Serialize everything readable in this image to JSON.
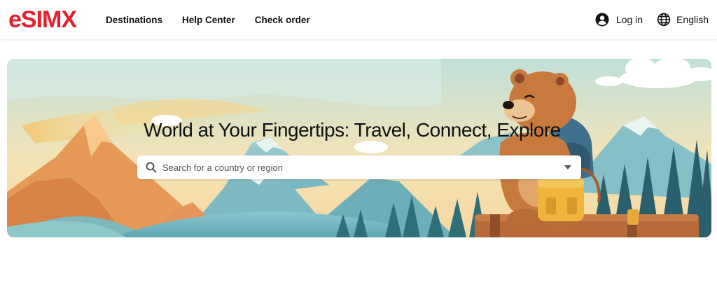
{
  "brand": {
    "logo_text": "eSIMX",
    "logo_color": "#e5202e"
  },
  "nav": {
    "items": [
      {
        "label": "Destinations"
      },
      {
        "label": "Help Center"
      },
      {
        "label": "Check order"
      }
    ]
  },
  "account": {
    "login_label": "Log in",
    "login_icon": "user-circle-icon"
  },
  "language": {
    "label": "English",
    "icon": "globe-icon"
  },
  "hero": {
    "title": "World at Your Fingertips: Travel, Connect, Explore",
    "illustration": "bear-traveler-with-backpack-and-suitcase-mountains"
  },
  "search": {
    "placeholder": "Search for a country or region",
    "value": "",
    "icon": "search-icon",
    "dropdown_icon": "caret-down-icon"
  }
}
